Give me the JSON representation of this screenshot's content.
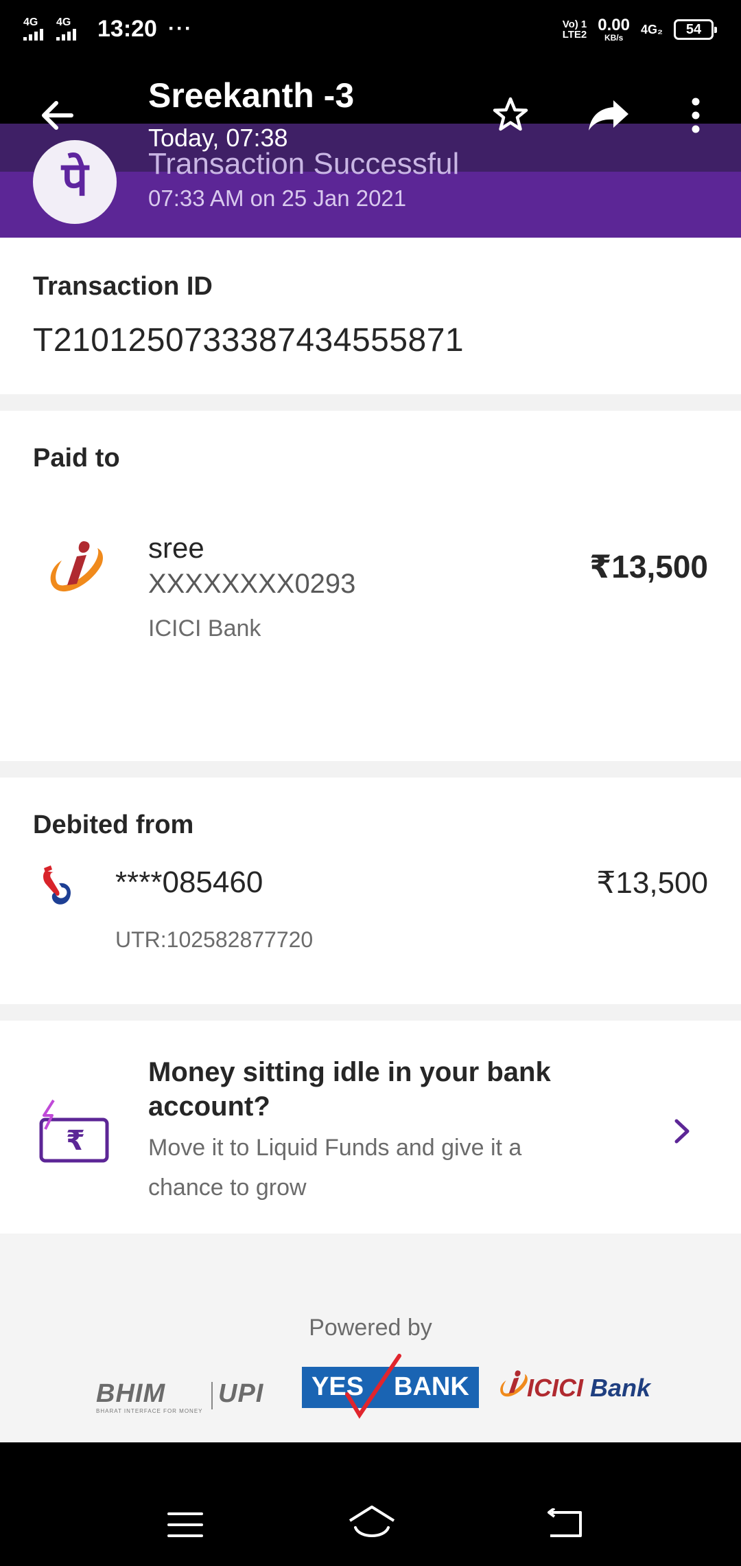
{
  "status_bar": {
    "sim1_label": "4G",
    "sim2_label": "4G",
    "time": "13:20",
    "more_dots": "···",
    "volte_line1": "Vo) 1",
    "volte_line2": "LTE2",
    "speed_value": "0.00",
    "speed_unit": "KB/s",
    "network": "4G₂",
    "battery": "54"
  },
  "header": {
    "contact_name": "Sreekanth -3",
    "contact_time": "Today, 07:38",
    "transaction_status": "Transaction Successful",
    "transaction_datetime": "07:33 AM on 25 Jan 2021",
    "logo_glyph": "पे",
    "icons": {
      "back": "arrow-left-icon",
      "star": "star-icon",
      "share": "share-icon",
      "more": "more-vertical-icon"
    }
  },
  "transaction": {
    "label": "Transaction ID",
    "id": "T2101250733387434555871"
  },
  "paid_to": {
    "label": "Paid to",
    "name": "sree",
    "account": "XXXXXXXX0293",
    "bank": "ICICI Bank",
    "amount": "₹13,500"
  },
  "debited_from": {
    "label": "Debited from",
    "account": "****085460",
    "amount": "₹13,500",
    "utr": "UTR:102582877720"
  },
  "promo": {
    "title": "Money sitting idle in your bank account?",
    "subtitle": "Move it to Liquid Funds and give it a chance to grow"
  },
  "footer": {
    "powered_by": "Powered by",
    "bhim": "BHIM",
    "bhim_tagline": "BHARAT INTERFACE FOR MONEY",
    "upi": "UPI",
    "yes": "YES",
    "bank": "BANK",
    "icici": "ICICI",
    "icici_bank": "Bank"
  },
  "colors": {
    "purple": "#5c2696",
    "purple_dark": "#3f2066",
    "icici_orange": "#f08a1c",
    "icici_red": "#b02a30",
    "yes_blue": "#1a64b3"
  }
}
